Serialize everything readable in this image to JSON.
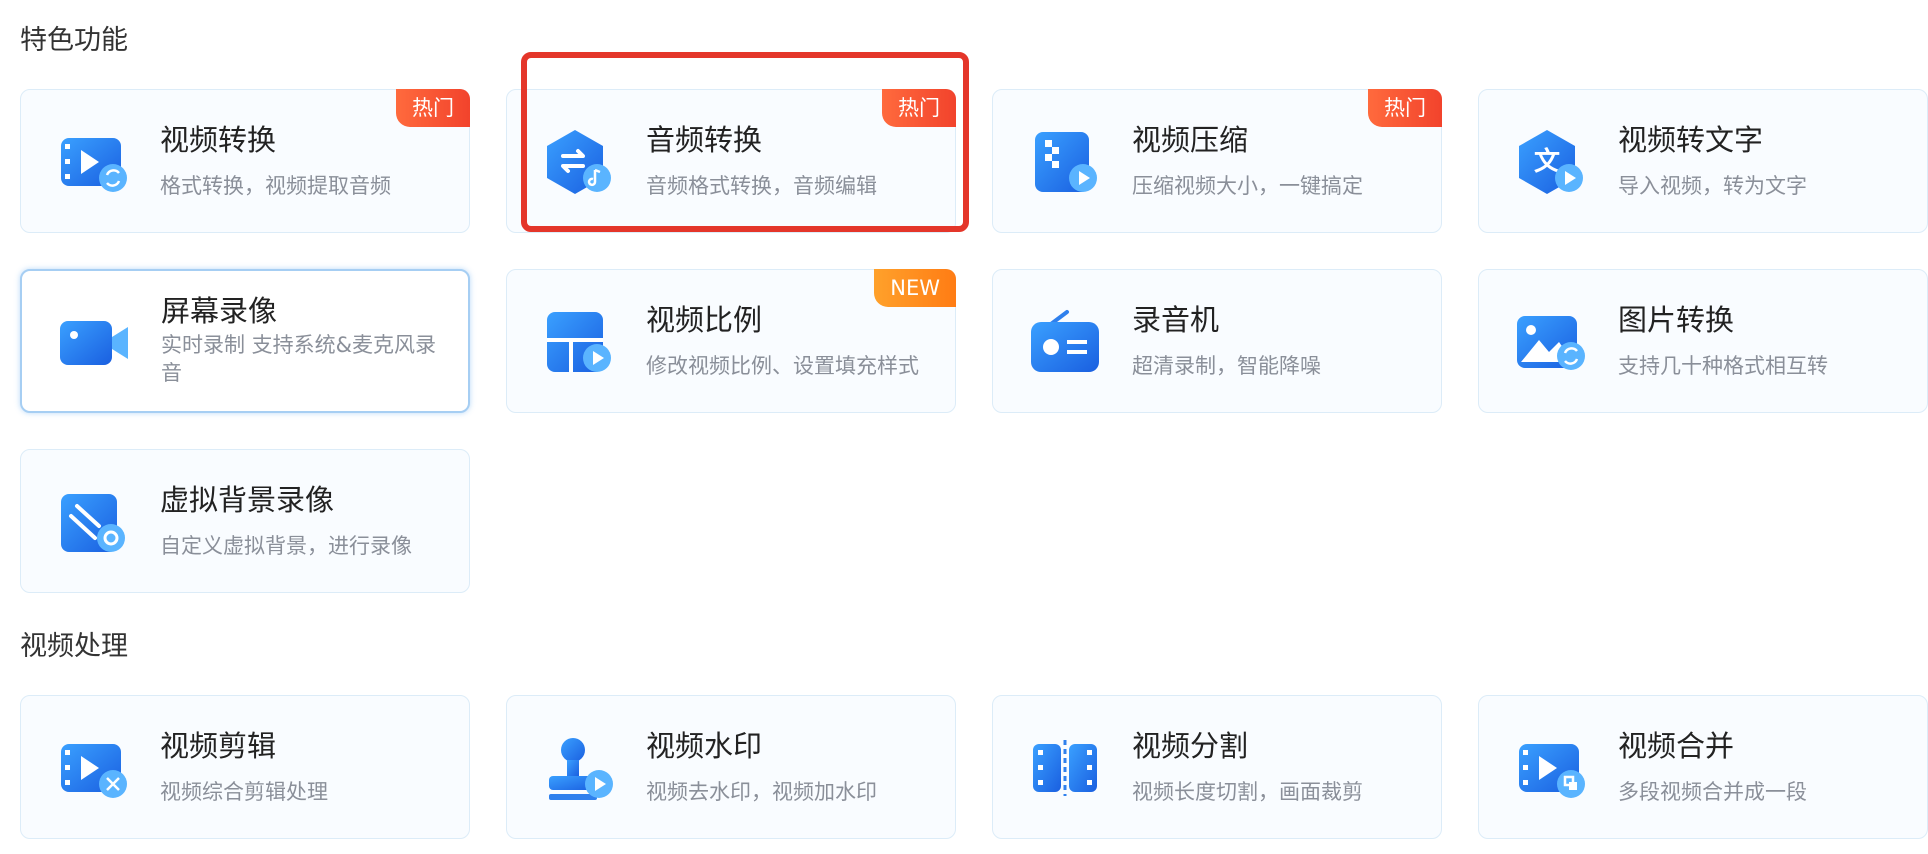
{
  "sections": [
    {
      "title": "特色功能",
      "cards": [
        {
          "title": "视频转换",
          "desc": "格式转换，视频提取音频",
          "badge": "热门",
          "icon": "video-convert-icon"
        },
        {
          "title": "音频转换",
          "desc": "音频格式转换，音频编辑",
          "badge": "热门",
          "icon": "audio-convert-icon"
        },
        {
          "title": "视频压缩",
          "desc": "压缩视频大小，一键搞定",
          "badge": "热门",
          "icon": "video-compress-icon"
        },
        {
          "title": "视频转文字",
          "desc": "导入视频，转为文字",
          "badge": "",
          "icon": "video-to-text-icon"
        },
        {
          "title": "屏幕录像",
          "desc": "实时录制 支持系统&麦克风录音",
          "badge": "",
          "icon": "screen-record-icon"
        },
        {
          "title": "视频比例",
          "desc": "修改视频比例、设置填充样式",
          "badge": "NEW",
          "icon": "video-ratio-icon"
        },
        {
          "title": "录音机",
          "desc": "超清录制，智能降噪",
          "badge": "",
          "icon": "recorder-icon"
        },
        {
          "title": "图片转换",
          "desc": "支持几十种格式相互转",
          "badge": "",
          "icon": "image-convert-icon"
        },
        {
          "title": "虚拟背景录像",
          "desc": "自定义虚拟背景，进行录像",
          "badge": "",
          "icon": "virtual-background-icon"
        }
      ]
    },
    {
      "title": "视频处理",
      "cards": [
        {
          "title": "视频剪辑",
          "desc": "视频综合剪辑处理",
          "badge": "",
          "icon": "video-edit-icon"
        },
        {
          "title": "视频水印",
          "desc": "视频去水印，视频加水印",
          "badge": "",
          "icon": "video-watermark-icon"
        },
        {
          "title": "视频分割",
          "desc": "视频长度切割，画面裁剪",
          "badge": "",
          "icon": "video-split-icon"
        },
        {
          "title": "视频合并",
          "desc": "多段视频合并成一段",
          "badge": "",
          "icon": "video-merge-icon"
        }
      ]
    }
  ],
  "colors": {
    "accent": "#2f80ed",
    "badge_hot": "#f2432c",
    "badge_new": "#ff8a1c",
    "highlight_box": "#e4362a"
  }
}
